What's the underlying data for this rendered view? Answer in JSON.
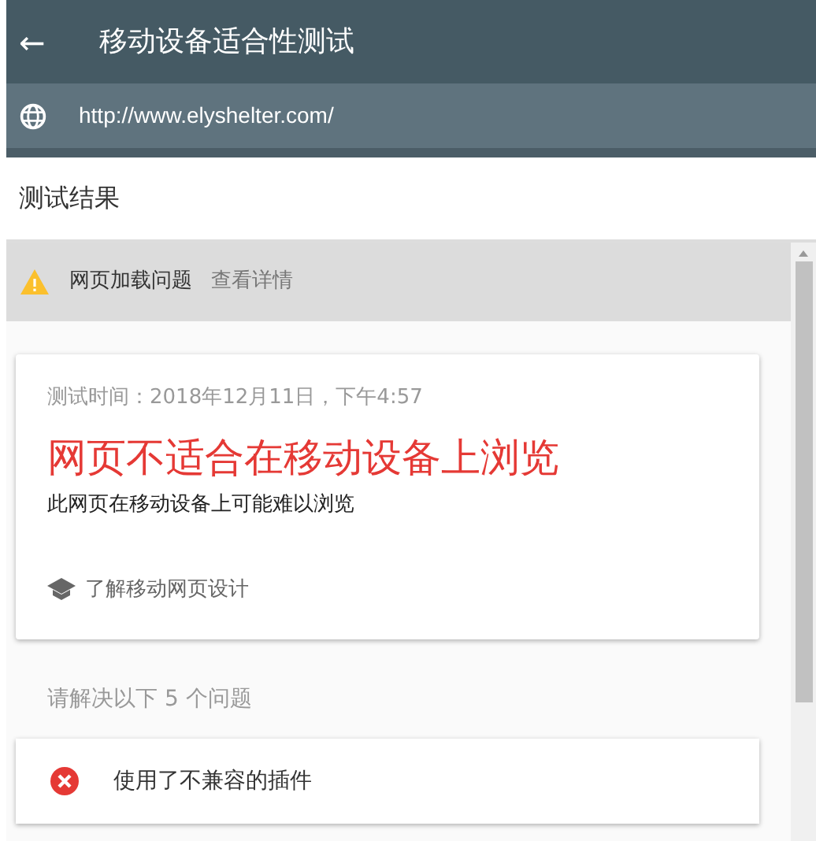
{
  "header": {
    "back_icon": "←",
    "title": "移动设备适合性测试"
  },
  "url_bar": {
    "url": "http://www.elyshelter.com/"
  },
  "section_title": "测试结果",
  "warning": {
    "label": "网页加载问题",
    "link": "查看详情"
  },
  "result_card": {
    "test_time": "测试时间：2018年12月11日，下午4:57",
    "verdict": "网页不适合在移动设备上浏览",
    "description": "此网页在移动设备上可能难以浏览",
    "learn_link": "了解移动网页设计"
  },
  "issues_heading": "请解决以下 5 个问题",
  "issues": [
    {
      "kind": "error",
      "text": "使用了不兼容的插件"
    }
  ]
}
